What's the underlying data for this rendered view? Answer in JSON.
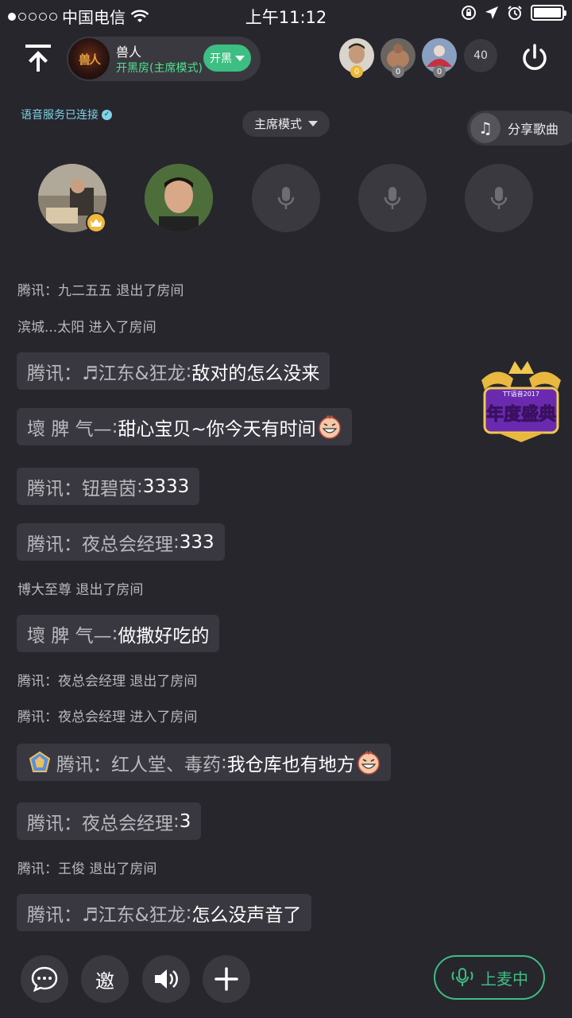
{
  "status_bar": {
    "carrier": "中国电信",
    "time": "上午11:12"
  },
  "header": {
    "room_logo_text": "兽人",
    "room_name": "兽人",
    "room_subtitle": "开黑房(主席模式)",
    "kaihei_label": "开黑",
    "viewer_badges": [
      "0",
      "0",
      "0"
    ],
    "viewer_count": "40"
  },
  "toolbar": {
    "voice_status": "语音服务已连接",
    "mode_label": "主席模式",
    "share_song_label": "分享歌曲"
  },
  "messages": [
    {
      "type": "system",
      "text": "腾讯：九二五五 退出了房间"
    },
    {
      "type": "system",
      "text": "滨城...太阳 进入了房间"
    },
    {
      "type": "chat",
      "sender": "腾讯：♬江东&狂龙",
      "content": "敌对的怎么没来",
      "emoji": false,
      "rank": false
    },
    {
      "type": "chat",
      "sender": "壞 脾 气—",
      "content": "甜心宝贝~你今天有时间",
      "emoji": true,
      "rank": false
    },
    {
      "type": "chat",
      "sender": "腾讯：钮碧茵",
      "content": "3333",
      "emoji": false,
      "rank": false
    },
    {
      "type": "chat",
      "sender": "腾讯：夜总会经理",
      "content": "333",
      "emoji": false,
      "rank": false
    },
    {
      "type": "system",
      "text": "博大至尊 退出了房间"
    },
    {
      "type": "chat",
      "sender": "壞 脾 气—",
      "content": "做撒好吃的",
      "emoji": false,
      "rank": false
    },
    {
      "type": "system",
      "text": "腾讯：夜总会经理 退出了房间"
    },
    {
      "type": "system",
      "text": "腾讯：夜总会经理 进入了房间"
    },
    {
      "type": "chat",
      "sender": "腾讯：红人堂、毒药",
      "content": "我仓库也有地方",
      "emoji": true,
      "rank": true
    },
    {
      "type": "chat",
      "sender": "腾讯：夜总会经理",
      "content": "3",
      "emoji": false,
      "rank": false
    },
    {
      "type": "system",
      "text": "腾讯：王俊 退出了房间"
    },
    {
      "type": "chat",
      "sender": "腾讯：♬江东&狂龙",
      "content": "怎么没声音了",
      "emoji": false,
      "rank": false
    }
  ],
  "annual_badge": {
    "top_text": "TT语音2017",
    "main_text": "年度盛典"
  },
  "bottom_bar": {
    "invite_label": "邀",
    "mic_up_label": "上麦中"
  },
  "colors": {
    "background": "#27262d",
    "accent_green": "#3dbe82",
    "bubble": "#393840",
    "voice_status": "#7fd3e8"
  }
}
